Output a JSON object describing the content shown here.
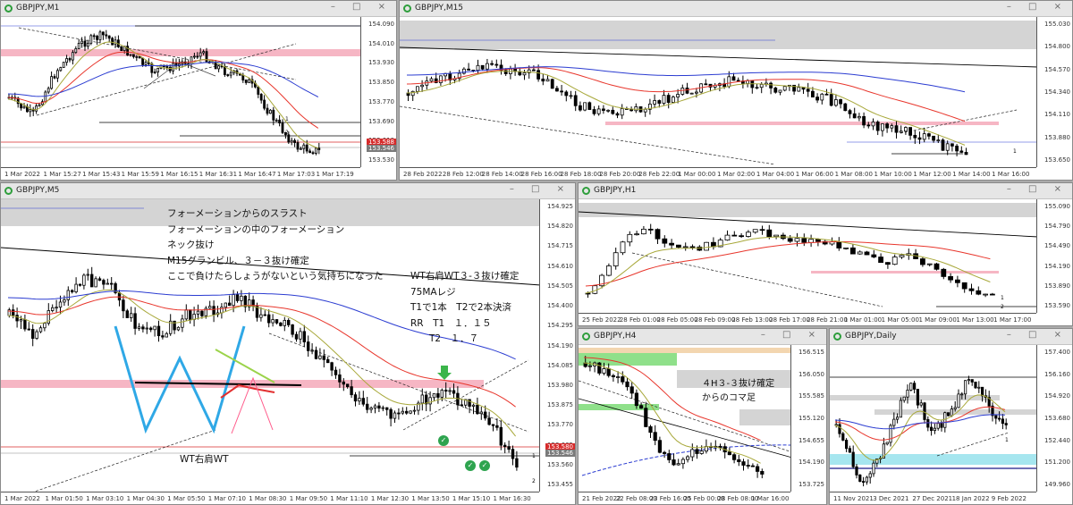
{
  "windows": {
    "m1": {
      "title": "GBPJPY,M1",
      "controls": "– □ ×",
      "yticks": [
        "154.090",
        "154.010",
        "153.930",
        "153.850",
        "153.770",
        "153.690",
        "153.610",
        "153.530"
      ],
      "xticks": [
        "1 Mar 2022",
        "1 Mar 15:27",
        "1 Mar 15:43",
        "1 Mar 15:59",
        "1 Mar 16:15",
        "1 Mar 16:31",
        "1 Mar 16:47",
        "1 Mar 17:03",
        "1 Mar 17:19"
      ],
      "price_tags": [
        {
          "text": "153.588",
          "color": "#d62b2b",
          "v": 153.588
        },
        {
          "text": "153.546",
          "color": "#7a7a7a",
          "v": 153.546
        }
      ],
      "marks": [
        "1",
        "2"
      ]
    },
    "m15": {
      "title": "GBPJPY,M15",
      "controls": "– □ ×",
      "yticks": [
        "155.030",
        "154.800",
        "154.570",
        "154.340",
        "154.110",
        "153.880",
        "153.650"
      ],
      "xticks": [
        "28 Feb 2022",
        "28 Feb 12:00",
        "28 Feb 14:00",
        "28 Feb 16:00",
        "28 Feb 18:00",
        "28 Feb 20:00",
        "28 Feb 22:00",
        "1 Mar 00:00",
        "1 Mar 02:00",
        "1 Mar 04:00",
        "1 Mar 06:00",
        "1 Mar 08:00",
        "1 Mar 10:00",
        "1 Mar 12:00",
        "1 Mar 14:00",
        "1 Mar 16:00"
      ],
      "marks": [
        "1"
      ]
    },
    "m5": {
      "title": "GBPJPY,M5",
      "controls": "– □ ×",
      "yticks": [
        "154.925",
        "154.820",
        "154.715",
        "154.610",
        "154.505",
        "154.400",
        "154.295",
        "154.190",
        "154.085",
        "153.980",
        "153.875",
        "153.770",
        "153.665",
        "153.560",
        "153.455"
      ],
      "xticks": [
        "1 Mar 2022",
        "1 Mar 01:50",
        "1 Mar 03:10",
        "1 Mar 04:30",
        "1 Mar 05:50",
        "1 Mar 07:10",
        "1 Mar 08:30",
        "1 Mar 09:50",
        "1 Mar 11:10",
        "1 Mar 12:30",
        "1 Mar 13:50",
        "1 Mar 15:10",
        "1 Mar 16:30"
      ],
      "price_tags": [
        {
          "text": "153.580",
          "color": "#d62b2b",
          "v": 153.58
        },
        {
          "text": "153.546",
          "color": "#7a7a7a",
          "v": 153.546
        }
      ],
      "notes_left": [
        "フォーメーションからのスラスト",
        "フォーメーションの中のフォーメーション",
        "ネック抜け",
        "M15グランビル、３－３抜け確定",
        "ここで負けたらしょうがないという気持ちになった"
      ],
      "notes_right": [
        "WT右肩WT３-３抜け確定",
        "75MAレジ",
        "T1で1本　T2で2本決済",
        "RR　T1　１．１５",
        "　　T2　１．７"
      ],
      "wt_label": "WT右肩WT",
      "marks": [
        "1",
        "2"
      ]
    },
    "h1": {
      "title": "GBPJPY,H1",
      "controls": "– □ ×",
      "yticks": [
        "155.090",
        "154.790",
        "154.490",
        "154.190",
        "153.890",
        "153.590"
      ],
      "xticks": [
        "25 Feb 2022",
        "28 Feb 01:00",
        "28 Feb 05:00",
        "28 Feb 09:00",
        "28 Feb 13:00",
        "28 Feb 17:00",
        "28 Feb 21:00",
        "1 Mar 01:00",
        "1 Mar 05:00",
        "1 Mar 09:00",
        "1 Mar 13:00",
        "1 Mar 17:00"
      ],
      "marks": [
        "1",
        "2"
      ]
    },
    "h4": {
      "title": "GBPJPY,H4",
      "controls": "– □ ×",
      "yticks": [
        "156.515",
        "156.050",
        "155.585",
        "155.120",
        "154.655",
        "154.190",
        "153.725"
      ],
      "xticks": [
        "21 Feb 2022",
        "22 Feb 08:00",
        "23 Feb 16:00",
        "25 Feb 00:00",
        "28 Feb 08:00",
        "1 Mar 16:00"
      ],
      "notes": [
        "４H３-３抜け確定",
        "からのコマ足"
      ]
    },
    "daily": {
      "title": "GBPJPY,Daily",
      "controls": "– □ ×",
      "yticks": [
        "157.400",
        "156.160",
        "154.920",
        "153.680",
        "152.440",
        "151.200",
        "149.960"
      ],
      "xticks": [
        "11 Nov 2021",
        "3 Dec 2021",
        "27 Dec 2021",
        "18 Jan 2022",
        "9 Feb 2022"
      ],
      "marks": [
        "1"
      ]
    }
  },
  "colors": {
    "up": "#ffffff",
    "down": "#000000",
    "ma_red": "#e8362c",
    "ma_olive": "#a8a83a",
    "ma_blue": "#2b3cd1",
    "pink_zone": "#f6b6c4",
    "gray_zone": "#d4d4d4",
    "green_zone": "#8fe08a",
    "cyan_zone": "#a6e6ef",
    "wt_blue": "#2fa8e6",
    "check_green": "#2ea44f"
  }
}
